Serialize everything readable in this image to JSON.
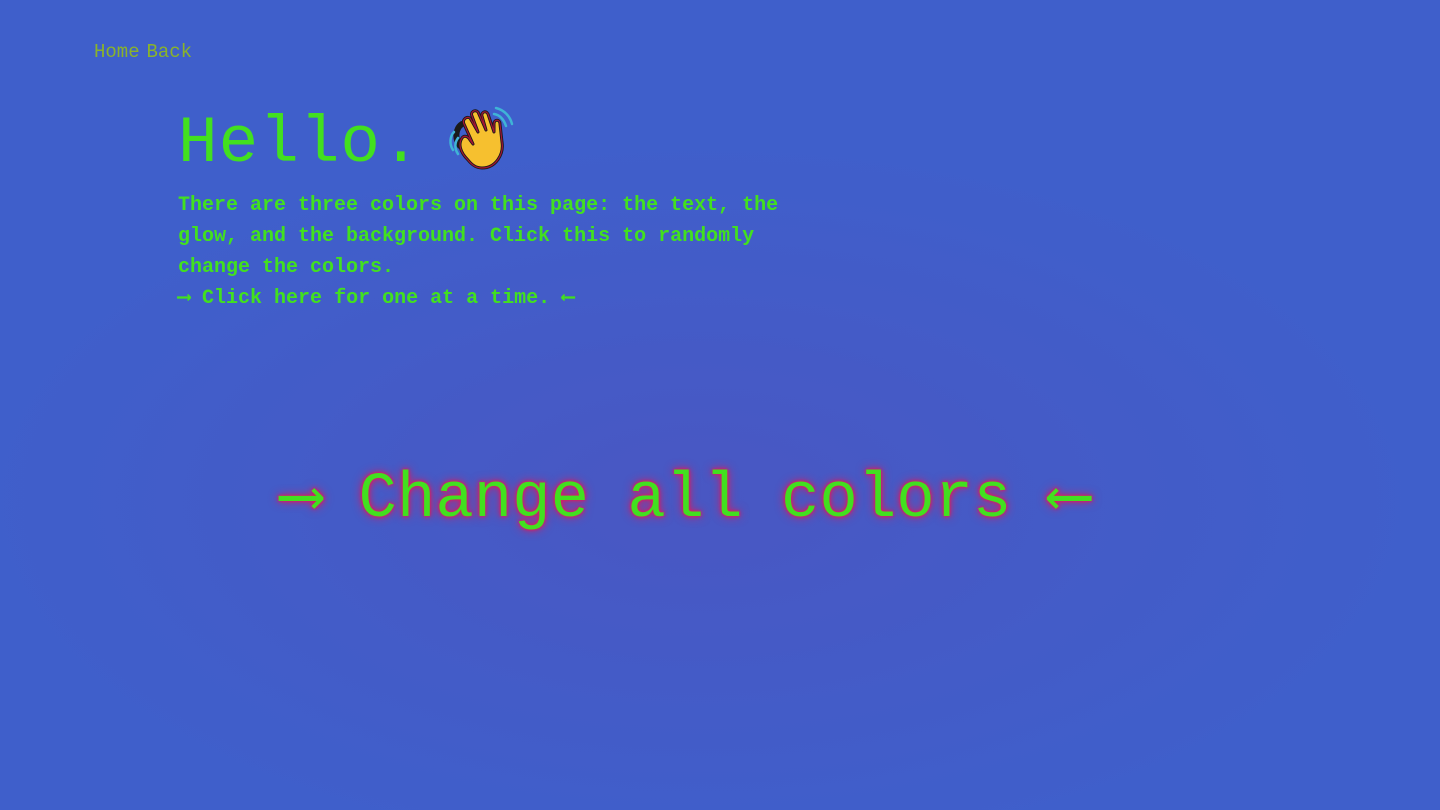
{
  "nav": {
    "home_label": "Home",
    "back_label": "Back"
  },
  "intro": {
    "heading": "Hello.",
    "wave_icon": "waving-hand-icon",
    "description": "There are three colors on this page: the text, the glow, and the background. Click this to randomly change the colors.",
    "one_at_a_time": "⟶ Click here for one at a time. ⟵"
  },
  "main": {
    "change_all_label": "⟶ Change all colors ⟵"
  },
  "colors": {
    "background": "#3f5fcb",
    "text": "#42e01f",
    "glow": "#e0195d",
    "nav_text": "#8ab32a"
  }
}
